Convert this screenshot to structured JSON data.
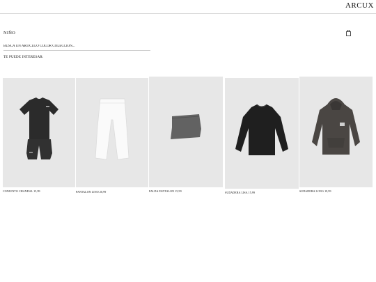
{
  "brand": {
    "logo": "ARCUX"
  },
  "page": {
    "title": "NIÑO"
  },
  "search": {
    "placeholder": "BUSCA UN ARTÍCULO COLOR COLECCIÓN..."
  },
  "recommendations": {
    "title": "TE PUEDE INTERESAR:",
    "products": [
      {
        "name": "CONJUNTO CHANDAL",
        "price": "15,99",
        "caption": "CONJUNTO CHANDAL 15,99"
      },
      {
        "name": "PANTALON LINO",
        "price": "20,99",
        "caption": "PANTALON LINO 20,99"
      },
      {
        "name": "FALDA PANTALON",
        "price": "15,99",
        "caption": "FALDA PANTALON 15,99"
      },
      {
        "name": "SUDADERA LISA",
        "price": "15,99",
        "caption": "SUDADERA LISA 15,99"
      },
      {
        "name": "SUDADERA LONG",
        "price": "19,99",
        "caption": "SUDADERA LONG 19,99"
      }
    ]
  },
  "icons": {
    "bag": "shopping-bag-icon"
  },
  "colors": {
    "background": "#ffffff",
    "photo_background": "#e7e7e7",
    "text": "#111111",
    "divider": "#d9d9d9"
  }
}
